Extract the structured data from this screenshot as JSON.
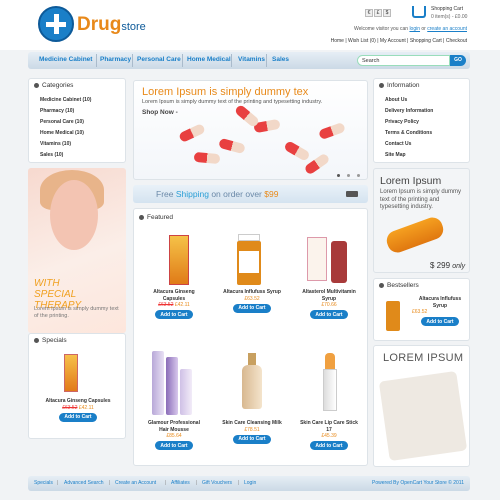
{
  "brand": {
    "name_a": "Drug",
    "name_b": "store"
  },
  "header": {
    "currency": [
      "€",
      "£",
      "$"
    ],
    "cart_title": "Shopping Cart",
    "cart_summary": "0 item(s) - £0.00",
    "welcome": "Welcome visitor you can",
    "login": "login",
    "or": "or",
    "create_account": "create an account",
    "top_links": "Home | Wish List (0) | My Account | Shopping Cart | Checkout"
  },
  "nav": {
    "items": [
      "Medicine Cabinet",
      "Pharmacy",
      "Personal Care",
      "Home Medical",
      "Vitamins",
      "Sales"
    ],
    "search_placeholder": "Search",
    "go_label": "GO"
  },
  "categories": {
    "title": "Categories",
    "items": [
      "Medicine Cabinet (10)",
      "Pharmacy (10)",
      "Personal Care (10)",
      "Home Medical (10)",
      "Vitamins (10)",
      "Sales (10)"
    ]
  },
  "promo_left": {
    "line1": "WITH",
    "line2": "SPECIAL THERAPY",
    "text": "Lorem Ipsum is simply dummy text of the printing."
  },
  "specials": {
    "title": "Specials",
    "product": {
      "name": "Altacura Ginseng Capsules",
      "old_price": "£63.52",
      "price": "£42.11",
      "button": "Add to Cart"
    }
  },
  "slideshow": {
    "title": "Lorem Ipsum is simply dummy tex",
    "subtitle": "Lorem Ipsum is simply dummy text of the printing and typesetting industry.",
    "shop_now": "Shop Now -"
  },
  "shipping": {
    "free": "Free",
    "shipping": "Shipping",
    "rest": "on order over",
    "amount": "$99"
  },
  "featured": {
    "title": "Featured",
    "products": [
      {
        "name": "Altacura Ginseng Capsules",
        "old_price": "£63.52",
        "price": "£42.11",
        "button": "Add to Cart"
      },
      {
        "name": "Altacura Influfuss Syrup",
        "old_price": "",
        "price": "£63.52",
        "button": "Add to Cart"
      },
      {
        "name": "Altasterol Multivitamin Syrup",
        "old_price": "",
        "price": "£70.66",
        "button": "Add to Cart"
      },
      {
        "name": "Glamour Professional Hair Mousse",
        "old_price": "",
        "price": "£85.64",
        "button": "Add to Cart"
      },
      {
        "name": "Skin Care Cleansing Milk",
        "old_price": "",
        "price": "£78.51",
        "button": "Add to Cart"
      },
      {
        "name": "Skin Care Lip Care Stick 17",
        "old_price": "",
        "price": "£45.39",
        "button": "Add to Cart"
      }
    ]
  },
  "information": {
    "title": "Information",
    "items": [
      "About Us",
      "Delivery Information",
      "Privacy Policy",
      "Terms & Conditions",
      "Contact Us",
      "Site Map"
    ]
  },
  "side_promo": {
    "title": "Lorem Ipsum",
    "text": "Lorem Ipsum is simply dummy text of the printing and typesetting industry.",
    "price": "$ 299",
    "only": "only"
  },
  "bestsellers": {
    "title": "Bestsellers",
    "product": {
      "name": "Altacura Influfuss Syrup",
      "price": "£63.52",
      "button": "Add to Cart"
    }
  },
  "lorem_box": {
    "title": "LOREM IPSUM"
  },
  "footer": {
    "links": [
      "Specials",
      "Advanced Search",
      "Create an Account",
      "Affiliates",
      "Gift Vouchers",
      "Login"
    ],
    "powered": "Powered By OpenCart Your Store © 2011"
  },
  "colors": {
    "accent": "#1a7fc8",
    "orange": "#e88a1a",
    "price": "#e88a1a"
  }
}
